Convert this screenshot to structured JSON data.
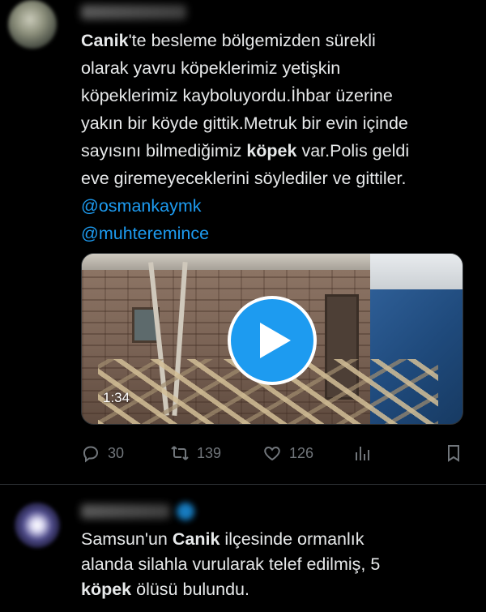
{
  "tweet1": {
    "text_line1_bold": "Canik",
    "text_line1_rest": "'te besleme bölgemizden sürekli",
    "text_line2": "olarak yavru köpeklerimiz yetişkin",
    "text_line3": "köpeklerimiz kayboluyordu.İhbar üzerine",
    "text_line4": "yakın bir köyde gittik.Metruk bir evin içinde",
    "text_line5_pre": "sayısını bilmediğimiz ",
    "text_line5_bold": "köpek",
    "text_line5_post": " var.Polis geldi",
    "text_line6": "eve giremeyeceklerini söylediler ve gittiler.",
    "mention1": "@osmankaymk",
    "mention2": "@muhteremince",
    "media": {
      "type": "video",
      "duration": "1:34",
      "play_icon": "play-icon"
    },
    "actions": {
      "replies": "30",
      "retweets": "139",
      "likes": "126"
    }
  },
  "tweet2": {
    "line1_pre": "Samsun'un ",
    "line1_bold": "Canik",
    "line1_post": " ilçesinde ormanlık",
    "line2": "alanda silahla vurularak telef edilmiş, 5",
    "line3_bold": "köpek",
    "line3_post": " ölüsü bulundu."
  },
  "colors": {
    "background": "#000000",
    "text": "#e7e9ea",
    "accent": "#1d9bf0",
    "muted": "#71767b"
  }
}
